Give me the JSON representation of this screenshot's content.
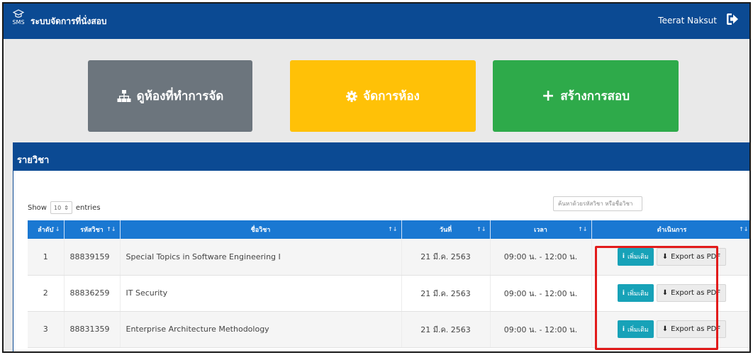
{
  "navbar": {
    "brand_icon_label": "SMS",
    "title": "ระบบจัดการที่นั่งสอบ",
    "user_name": "Teerat Naksut"
  },
  "actions": {
    "rooms_label": "ดูห้องที่ทำการจัด",
    "manage_label": "จัดการห้อง",
    "create_label": "สร้างการสอบ"
  },
  "panel": {
    "title": "รายวิชา",
    "show_label": "Show",
    "entries_label": "entries",
    "page_length": "10",
    "search_placeholder": "ค้นหาด้วยรหัสวิชา หรือชื่อวิชา"
  },
  "table": {
    "headers": [
      "ลำดับ",
      "รหัสวิชา",
      "ชื่อวิชา",
      "วันที่",
      "เวลา",
      "ดำเนินการ"
    ],
    "rows": [
      {
        "no": "1",
        "code": "88839159",
        "name": "Special Topics in Software Engineering I",
        "date": "21 มี.ค. 2563",
        "time": "09:00 น. - 12:00 น."
      },
      {
        "no": "2",
        "code": "88836259",
        "name": "IT Security",
        "date": "21 มี.ค. 2563",
        "time": "09:00 น. - 12:00 น."
      },
      {
        "no": "3",
        "code": "88831359",
        "name": "Enterprise Architecture Methodology",
        "date": "21 มี.ค. 2563",
        "time": "09:00 น. - 12:00 น."
      }
    ],
    "more_label": "เพิ่มเติม",
    "pdf_label": "Export as PDF"
  },
  "colors": {
    "navbar": "#0b4a93",
    "header_row": "#1a78d2",
    "btn_rooms": "#6c757d",
    "btn_manage": "#ffc107",
    "btn_create": "#2eaa4a",
    "btn_more": "#17a2b8",
    "highlight": "#e21b1b"
  }
}
